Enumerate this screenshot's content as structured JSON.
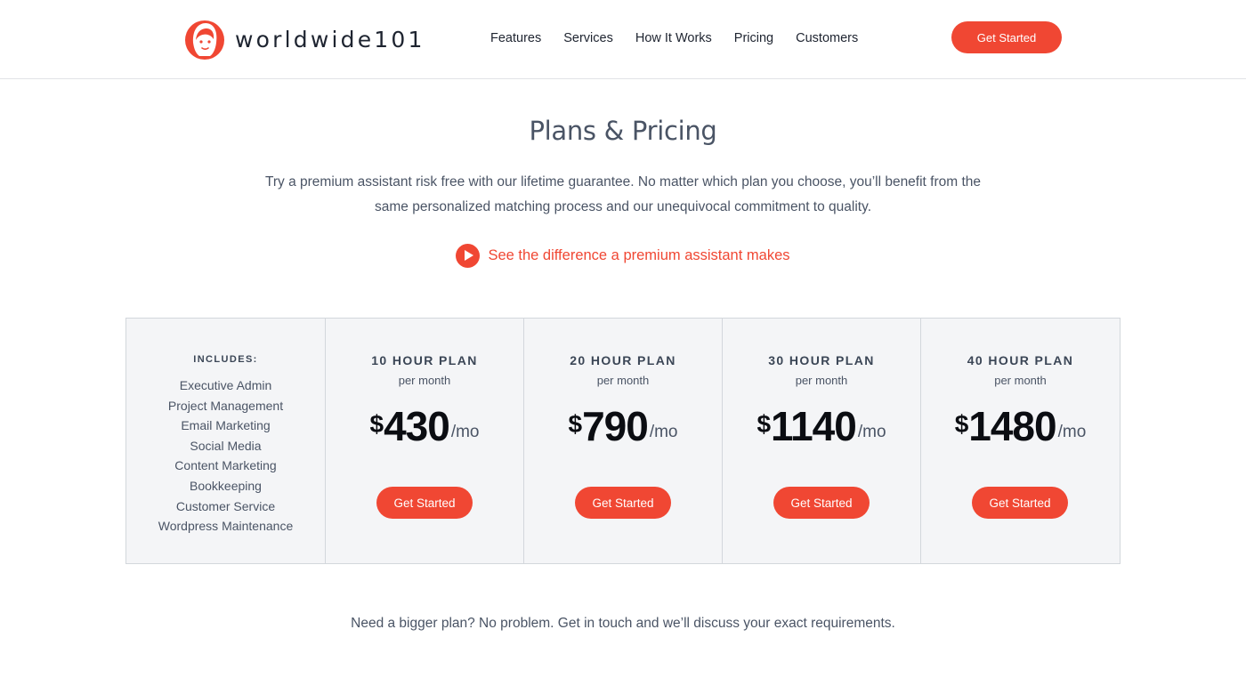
{
  "brand": {
    "name": "worldwide101",
    "accent": "#f04733"
  },
  "nav": {
    "items": [
      "Features",
      "Services",
      "How It Works",
      "Pricing",
      "Customers"
    ],
    "cta_label": "Get Started"
  },
  "hero": {
    "title": "Plans & Pricing",
    "intro": "Try a premium assistant risk free with our lifetime guarantee. No matter which plan you choose, you’ll benefit from the same personalized matching process and our unequivocal commitment to quality.",
    "video_link": "See the difference a premium assistant makes"
  },
  "includes": {
    "title": "INCLUDES:",
    "items": [
      "Executive Admin",
      "Project Management",
      "Email Marketing",
      "Social Media",
      "Content Marketing",
      "Bookkeeping",
      "Customer Service",
      "Wordpress Maintenance"
    ]
  },
  "plans": [
    {
      "name": "10 HOUR PLAN",
      "period": "per month",
      "currency": "$",
      "amount": "430",
      "unit": "/mo",
      "cta": "Get Started"
    },
    {
      "name": "20 HOUR PLAN",
      "period": "per month",
      "currency": "$",
      "amount": "790",
      "unit": "/mo",
      "cta": "Get Started"
    },
    {
      "name": "30 HOUR PLAN",
      "period": "per month",
      "currency": "$",
      "amount": "1140",
      "unit": "/mo",
      "cta": "Get Started"
    },
    {
      "name": "40 HOUR PLAN",
      "period": "per month",
      "currency": "$",
      "amount": "1480",
      "unit": "/mo",
      "cta": "Get Started"
    }
  ],
  "footer_note": "Need a bigger plan? No problem. Get in touch and we’ll discuss your exact requirements."
}
